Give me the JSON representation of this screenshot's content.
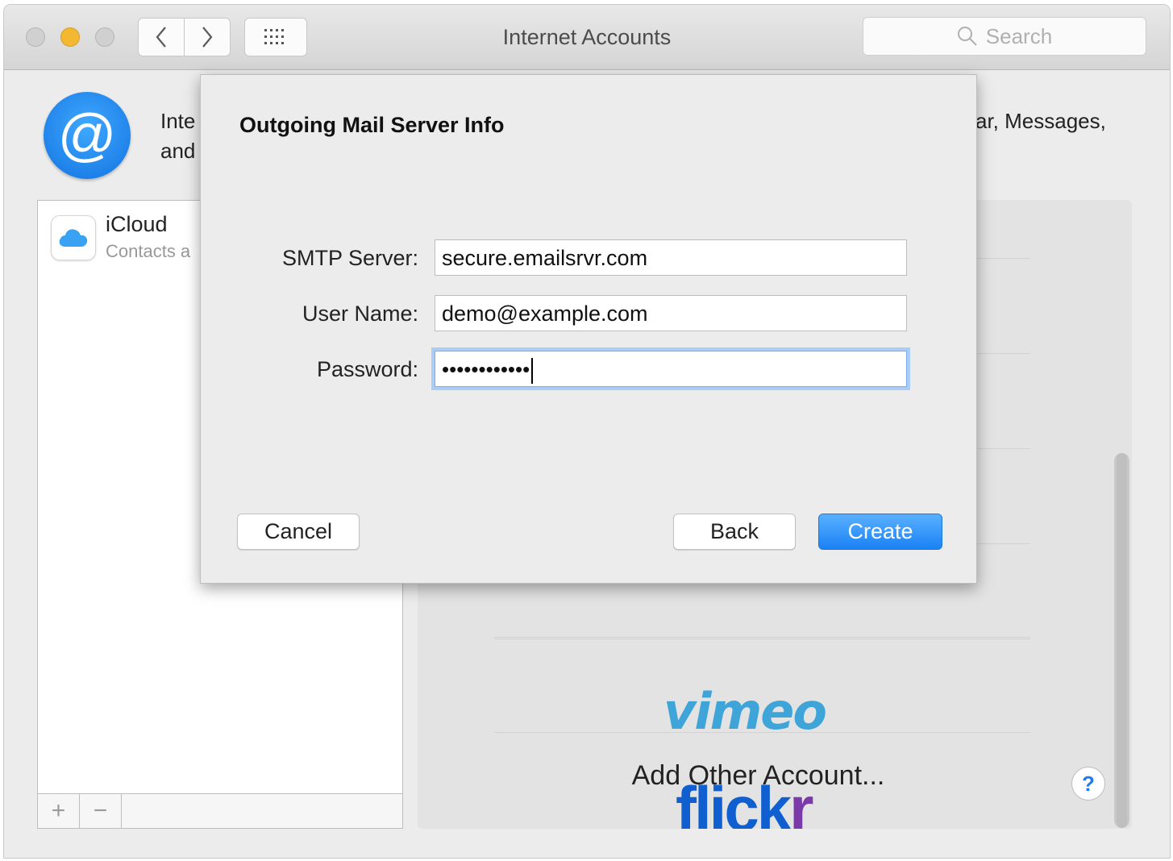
{
  "window": {
    "title": "Internet Accounts"
  },
  "search": {
    "placeholder": "Search"
  },
  "header": {
    "desc_left_line1": "Inte",
    "desc_left_line2": "and",
    "desc_right_line1": "ar, Messages,"
  },
  "accounts": [
    {
      "name": "iCloud",
      "subtitle": "Contacts a"
    }
  ],
  "list_footer": {
    "add_symbol": "+",
    "remove_symbol": "−"
  },
  "providers": {
    "vimeo_logo": "vimeo",
    "flickr_logo_part1": "flick",
    "flickr_logo_part2": "r",
    "add_other": "Add Other Account..."
  },
  "help": {
    "label": "?"
  },
  "sheet": {
    "title": "Outgoing Mail Server Info",
    "fields": [
      {
        "label": "SMTP Server:",
        "value": "secure.emailsrvr.com"
      },
      {
        "label": "User Name:",
        "value": "demo@example.com"
      },
      {
        "label": "Password:",
        "value": "••••••••••••"
      }
    ],
    "buttons": {
      "cancel": "Cancel",
      "back": "Back",
      "create": "Create"
    }
  },
  "icons": [
    "back-chevron-icon",
    "forward-chevron-icon",
    "grid-icon",
    "search-icon",
    "at-sign-icon",
    "icloud-icon",
    "help-icon"
  ],
  "colors": {
    "accent": "#1a82f5",
    "minimize": "#f3b832",
    "vimeo": "#3fa5d8",
    "flickr_blue": "#0f5fd0",
    "flickr_purple": "#7a3aa8"
  }
}
